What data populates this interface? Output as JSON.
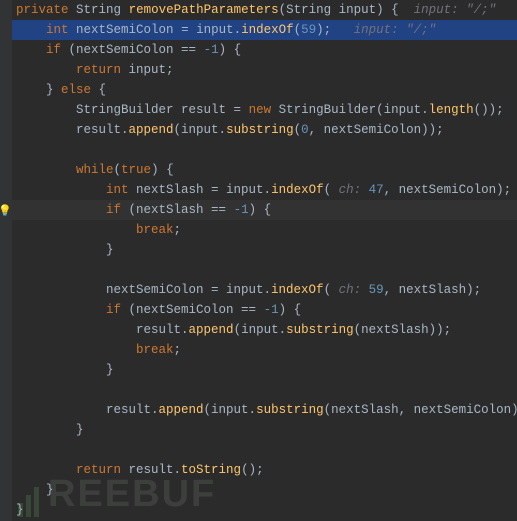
{
  "code": {
    "l1_private": "private",
    "l1_type": "String",
    "l1_method": "removePathParameters",
    "l1_param_type": "String",
    "l1_param_name": "input",
    "l1_brace": ") {",
    "l1_hint": "  input: \"/;\"",
    "l2_int": "int",
    "l2_var": "nextSemiColon",
    "l2_eq": " = input.",
    "l2_call": "indexOf",
    "l2_open": "(",
    "l2_num": "59",
    "l2_close": ");",
    "l2_hint": "   input: \"/;\"",
    "l3_if": "if",
    "l3_cond": " (nextSemiColon == ",
    "l3_neg1": "-1",
    "l3_close": ") {",
    "l4_return": "return",
    "l4_val": " input;",
    "l5_else_close": "}",
    "l5_else": " else ",
    "l5_open": "{",
    "l6_type": "StringBuilder",
    "l6_var": " result = ",
    "l6_new": "new",
    "l6_ctor": " StringBuilder(input.",
    "l6_len": "length",
    "l6_end": "());",
    "l7_res": "result.",
    "l7_append": "append",
    "l7_open": "(input.",
    "l7_sub": "substring",
    "l7_args_open": "(",
    "l7_zero": "0",
    "l7_args_mid": ", nextSemiColon));",
    "l9_while": "while",
    "l9_open": "(",
    "l9_true": "true",
    "l9_close": ") {",
    "l10_int": "int",
    "l10_var": " nextSlash = input.",
    "l10_call": "indexOf",
    "l10_open": "(",
    "l10_hint": " ch: ",
    "l10_num": "47",
    "l10_mid": ", nextSemiColon);",
    "l11_if": "if",
    "l11_cond": " (nextSlash == ",
    "l11_neg1": "-1",
    "l11_close": ") {",
    "l12_break": "break",
    "l12_semi": ";",
    "l13_brace": "}",
    "l15_assign": "nextSemiColon = input.",
    "l15_call": "indexOf",
    "l15_open": "(",
    "l15_hint": " ch: ",
    "l15_num": "59",
    "l15_mid": ", nextSlash);",
    "l16_if": "if",
    "l16_cond": " (nextSemiColon == ",
    "l16_neg1": "-1",
    "l16_close": ") {",
    "l17_res": "result.",
    "l17_append": "append",
    "l17_open": "(input.",
    "l17_sub": "substring",
    "l17_args": "(nextSlash));",
    "l18_break": "break",
    "l18_semi": ";",
    "l19_brace": "}",
    "l21_res": "result.",
    "l21_append": "append",
    "l21_open": "(input.",
    "l21_sub": "substring",
    "l21_args": "(nextSlash, nextSemiColon));",
    "l22_brace": "}",
    "l24_return": "return",
    "l24_val": " result.",
    "l24_tostr": "toString",
    "l24_end": "();",
    "l25_brace": "}",
    "l26_brace": "}"
  },
  "gutter": {
    "bulb_icon": "💡"
  },
  "watermark": {
    "text": "REEBUF"
  }
}
